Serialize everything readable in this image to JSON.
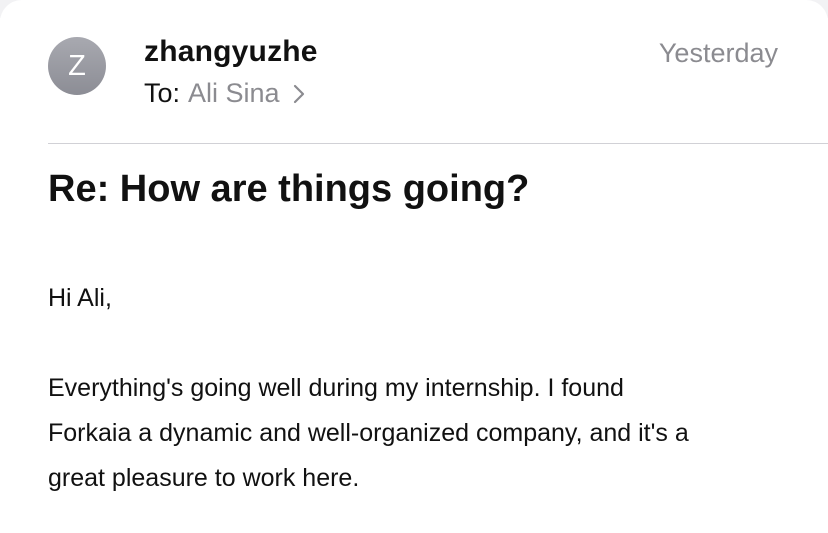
{
  "message": {
    "avatar_initial": "Z",
    "sender": "zhangyuzhe",
    "date": "Yesterday",
    "to_label": "To:",
    "recipient": "Ali Sina",
    "subject": "Re: How are things going?",
    "greeting": "Hi Ali,",
    "body_lines": [
      "Everything's going well during my internship. I found",
      "Forkaia a dynamic and well-organized company, and it's a",
      "great pleasure to work here."
    ]
  },
  "icons": {
    "avatar": "avatar-initial",
    "recipient_disclosure": "chevron-right-icon"
  },
  "colors": {
    "secondary_text": "#8b8b90",
    "avatar_background": "#9a9ba3",
    "divider": "#d1d1d6"
  }
}
